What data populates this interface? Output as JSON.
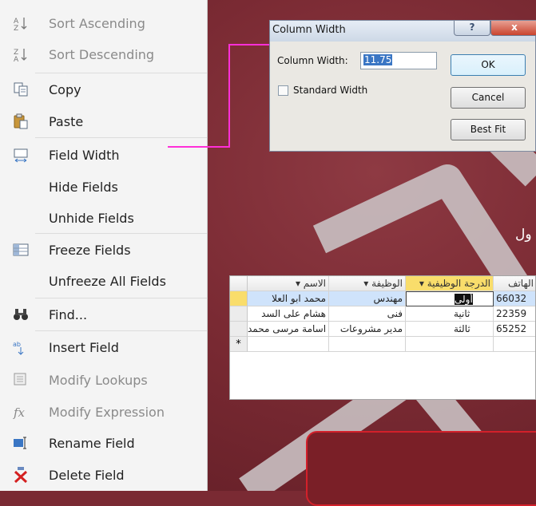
{
  "context_menu": {
    "items": [
      {
        "label": "Sort Ascending",
        "icon": "sort-ascending-icon",
        "disabled": true
      },
      {
        "label": "Sort Descending",
        "icon": "sort-descending-icon",
        "disabled": true
      },
      {
        "label": "Copy",
        "icon": "copy-icon",
        "disabled": false
      },
      {
        "label": "Paste",
        "icon": "paste-icon",
        "disabled": false
      },
      {
        "label": "Field Width",
        "icon": "field-width-icon",
        "disabled": false
      },
      {
        "label": "Hide Fields",
        "icon": "",
        "disabled": false
      },
      {
        "label": "Unhide Fields",
        "icon": "",
        "disabled": false
      },
      {
        "label": "Freeze Fields",
        "icon": "freeze-fields-icon",
        "disabled": false
      },
      {
        "label": "Unfreeze All Fields",
        "icon": "",
        "disabled": false
      },
      {
        "label": "Find...",
        "icon": "binoculars-icon",
        "disabled": false
      },
      {
        "label": "Insert Field",
        "icon": "insert-field-icon",
        "disabled": false
      },
      {
        "label": "Modify Lookups",
        "icon": "modify-lookups-icon",
        "disabled": true
      },
      {
        "label": "Modify Expression",
        "icon": "fx-icon",
        "disabled": true
      },
      {
        "label": "Rename Field",
        "icon": "rename-field-icon",
        "disabled": false
      },
      {
        "label": "Delete Field",
        "icon": "delete-field-icon",
        "disabled": false
      }
    ]
  },
  "dialog": {
    "title": "Column Width",
    "help_label": "?",
    "close_label": "x",
    "width_label": "Column Width:",
    "width_value": "11.75",
    "standard_width_label": "Standard Width",
    "standard_width_checked": false,
    "ok_label": "OK",
    "cancel_label": "Cancel",
    "best_fit_label": "Best Fit"
  },
  "slide_heading_fragment": "ول",
  "datasheet": {
    "columns": [
      "الاسم",
      "الوظيفة",
      "الدرجة الوظيفية",
      "الهاتف"
    ],
    "rows": [
      [
        "محمد ابو العلا",
        "مهندس",
        "أولى",
        "66032"
      ],
      [
        "هشام على السد",
        "فنى",
        "ثانية",
        "22359"
      ],
      [
        "اسامة مرسى محمد",
        "مدير مشروعات",
        "ثالثة",
        "65252"
      ]
    ],
    "new_record_marker": "*"
  },
  "colors": {
    "background": "#7a2a33",
    "arrow": "#ff2fd8",
    "selected_row": "#cfe3fb",
    "selected_header": "#f9dd6b",
    "red_box_border": "#d3202a"
  }
}
